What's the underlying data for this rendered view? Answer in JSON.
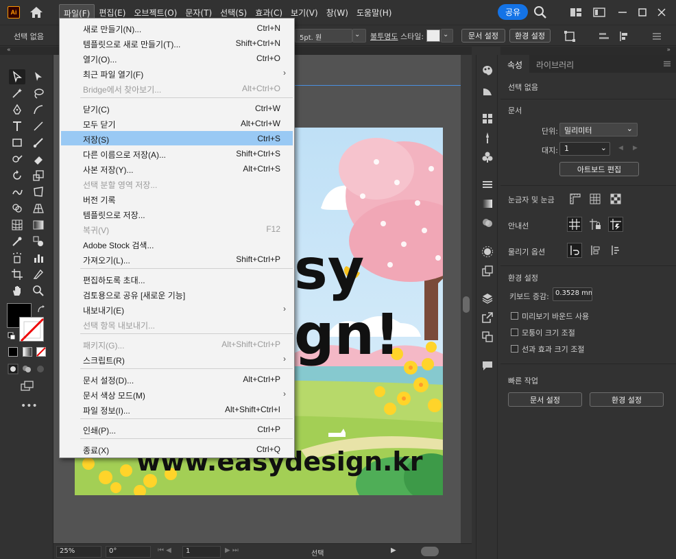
{
  "menubar": {
    "logo": "Ai",
    "items": [
      "파일(F)",
      "편집(E)",
      "오브젝트(O)",
      "문자(T)",
      "선택(S)",
      "효과(C)",
      "보기(V)",
      "창(W)",
      "도움말(H)"
    ],
    "share_label": "공유"
  },
  "controlbar": {
    "selection": "선택 없음",
    "stroke_size": "5pt. 원",
    "opacity_label": "불투명도",
    "style_label": "스타일:",
    "doc_setup": "문서 설정",
    "prefs": "환경 설정"
  },
  "file_menu": {
    "items": [
      {
        "label": "새로 만들기(N)...",
        "shortcut": "Ctrl+N"
      },
      {
        "label": "템플릿으로 새로 만들기(T)...",
        "shortcut": "Shift+Ctrl+N"
      },
      {
        "label": "열기(O)...",
        "shortcut": "Ctrl+O"
      },
      {
        "label": "최근 파일 열기(F)",
        "shortcut": ""
      },
      {
        "label": "Bridge에서 찾아보기...",
        "shortcut": "Alt+Ctrl+O"
      },
      {
        "label": "닫기(C)",
        "shortcut": "Ctrl+W"
      },
      {
        "label": "모두 닫기",
        "shortcut": "Alt+Ctrl+W"
      },
      {
        "label": "저장(S)",
        "shortcut": "Ctrl+S"
      },
      {
        "label": "다른 이름으로 저장(A)...",
        "shortcut": "Shift+Ctrl+S"
      },
      {
        "label": "사본 저장(Y)...",
        "shortcut": "Alt+Ctrl+S"
      },
      {
        "label": "선택 분할 영역 저장...",
        "shortcut": ""
      },
      {
        "label": "버전 기록",
        "shortcut": ""
      },
      {
        "label": "템플릿으로 저장...",
        "shortcut": ""
      },
      {
        "label": "복귀(V)",
        "shortcut": "F12"
      },
      {
        "label": "Adobe Stock 검색...",
        "shortcut": ""
      },
      {
        "label": "가져오기(L)...",
        "shortcut": "Shift+Ctrl+P"
      },
      {
        "label": "편집하도록 초대...",
        "shortcut": ""
      },
      {
        "label": "검토용으로 공유 [새로운 기능]",
        "shortcut": ""
      },
      {
        "label": "내보내기(E)",
        "shortcut": ""
      },
      {
        "label": "선택 항목 내보내기...",
        "shortcut": ""
      },
      {
        "label": "패키지(G)...",
        "shortcut": "Alt+Shift+Ctrl+P"
      },
      {
        "label": "스크립트(R)",
        "shortcut": ""
      },
      {
        "label": "문서 설정(D)...",
        "shortcut": "Alt+Ctrl+P"
      },
      {
        "label": "문서 색상 모드(M)",
        "shortcut": ""
      },
      {
        "label": "파일 정보(I)...",
        "shortcut": "Alt+Shift+Ctrl+I"
      },
      {
        "label": "인쇄(P)...",
        "shortcut": "Ctrl+P"
      },
      {
        "label": "종료(X)",
        "shortcut": "Ctrl+Q"
      }
    ]
  },
  "artwork": {
    "title_line1": "sy",
    "title_line2": "gn!",
    "url": "www.easydesign.kr"
  },
  "statusbar": {
    "zoom": "25%",
    "rotation": "0°",
    "artboard_num": "1",
    "tool_name": "선택"
  },
  "properties": {
    "tabs": [
      "속성",
      "라이브러리"
    ],
    "no_selection": "선택 없음",
    "document_section": "문서",
    "units_label": "단위:",
    "units_value": "밀리미터",
    "artboard_label": "대지:",
    "artboard_value": "1",
    "edit_artboard_btn": "아트보드 편집",
    "rulers_grids": "눈금자 및 눈금",
    "guides": "안내선",
    "snap_options": "물리기 옵션",
    "prefs_section": "환경 설정",
    "keyboard_increment_label": "키보드 증감:",
    "keyboard_increment_value": "0.3528 mm",
    "checkboxes": [
      "미리보기 바운드 사용",
      "모퉁이 크기 조절",
      "선과 효과 크기 조절"
    ],
    "quick_actions": "빠른 작업",
    "doc_setup_btn": "문서 설정",
    "prefs_btn": "환경 설정"
  }
}
